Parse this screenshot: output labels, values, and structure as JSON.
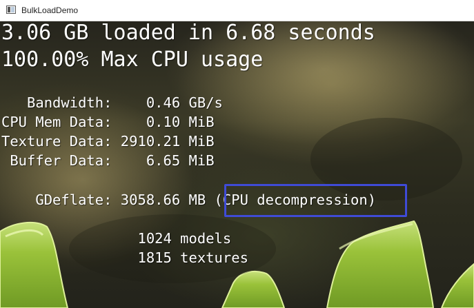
{
  "window": {
    "title": "BulkLoadDemo"
  },
  "summary": {
    "loaded_line": "3.06 GB loaded in 6.68 seconds",
    "cpu_line": "100.00% Max CPU usage"
  },
  "stats": {
    "bandwidth": "   Bandwidth:    0.46 GB/s",
    "cpu_mem": "CPU Mem Data:    0.10 MiB",
    "texture": "Texture Data: 2910.21 MiB",
    "buffer": " Buffer Data:    6.65 MiB",
    "gdeflate": "    GDeflate: 3058.66 MB (CPU decompression)",
    "models": "                1024 models",
    "textures": "                1815 textures"
  },
  "colors": {
    "highlight_border": "#3f4bd6",
    "text": "#ffffff",
    "foliage": "#9cc63a"
  }
}
